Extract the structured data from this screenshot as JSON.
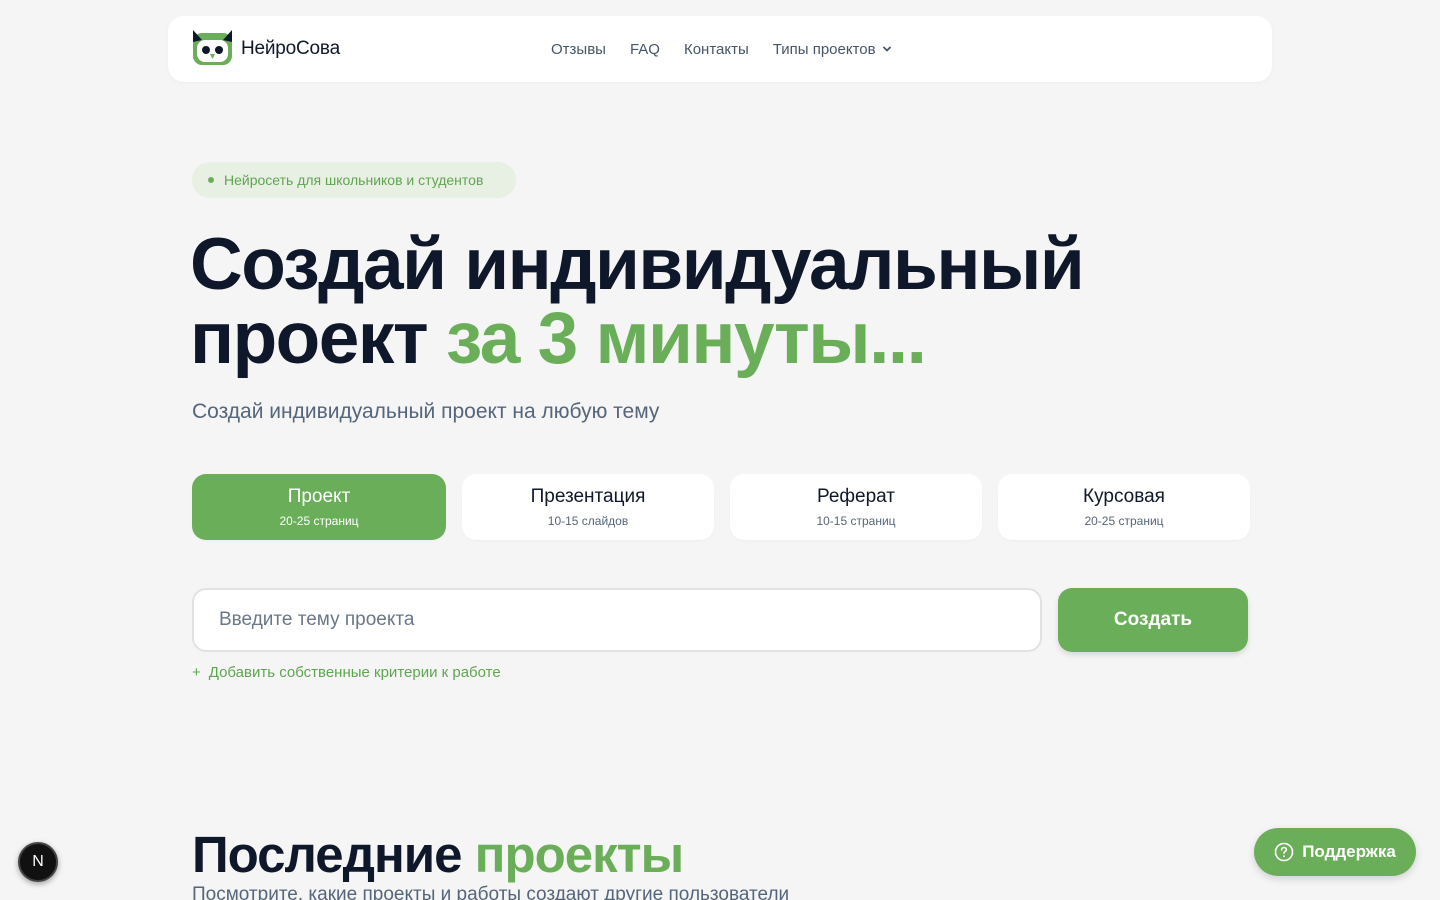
{
  "brand": {
    "name": "НейроСова",
    "accent": "#6aae59",
    "dark": "#0f172a"
  },
  "nav": {
    "items": [
      {
        "label": "Отзывы"
      },
      {
        "label": "FAQ"
      },
      {
        "label": "Контакты"
      },
      {
        "label": "Типы проектов",
        "icon": "chevron-down-icon"
      }
    ]
  },
  "hero": {
    "badge": "Нейросеть для школьников и студентов",
    "title_line1": "Создай индивидуальный",
    "title_line2_dark": "проект",
    "title_line2_green": "за 3 минуты...",
    "subtitle": "Создай индивидуальный проект на любую тему"
  },
  "types": [
    {
      "name": "Проект",
      "meta": "20-25 страниц",
      "selected": true
    },
    {
      "name": "Презентация",
      "meta": "10-15 слайдов",
      "selected": false
    },
    {
      "name": "Реферат",
      "meta": "10-15 страниц",
      "selected": false
    },
    {
      "name": "Курсовая",
      "meta": "20-25 страниц",
      "selected": false
    }
  ],
  "form": {
    "placeholder": "Введите тему проекта",
    "value": "",
    "submit_label": "Создать",
    "criteria_plus": "+",
    "criteria_label": "Добавить собственные критерии к работе"
  },
  "recent": {
    "title_dark": "Последние",
    "title_green": "проекты",
    "subtitle": "Посмотрите, какие проекты и работы создают другие пользователи"
  },
  "floating": {
    "dev_badge": "N",
    "support_label": "Поддержка",
    "support_icon": "help-circle-icon"
  }
}
